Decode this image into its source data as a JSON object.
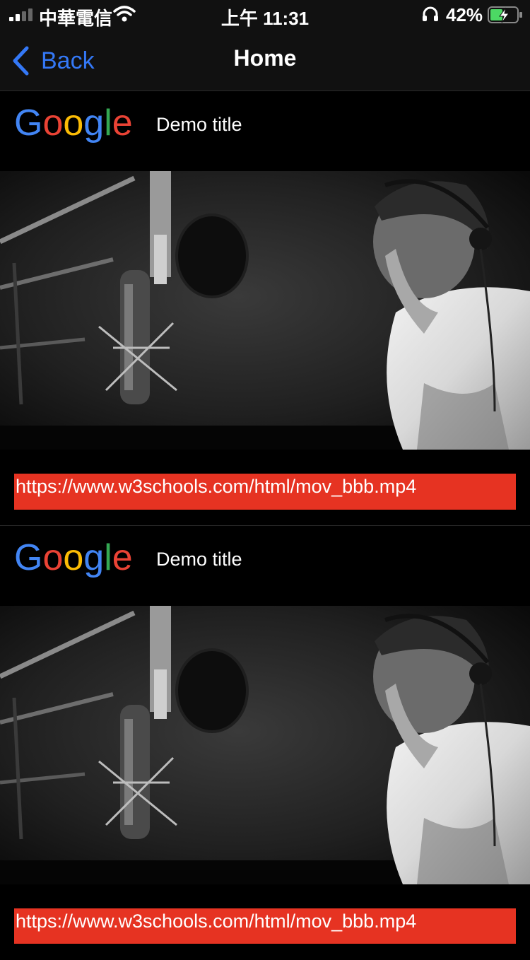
{
  "status_bar": {
    "carrier": "中華電信",
    "time": "上午 11:31",
    "battery_percent": "42%",
    "icons": [
      "signal-icon",
      "wifi-icon",
      "headphones-icon",
      "battery-charging-icon"
    ]
  },
  "nav": {
    "back_label": "Back",
    "title": "Home",
    "accent_color": "#3478f6"
  },
  "feed": [
    {
      "logo": "Google",
      "title": "Demo title",
      "url": "https://www.w3schools.com/html/mov_bbb.mp4"
    },
    {
      "logo": "Google",
      "title": "Demo title",
      "url": "https://www.w3schools.com/html/mov_bbb.mp4"
    }
  ],
  "colors": {
    "background": "#000000",
    "bar_background": "#111111",
    "url_bar": "#e63322",
    "google_blue": "#4285f4",
    "google_red": "#ea4335",
    "google_yellow": "#fbbc05",
    "google_green": "#34a853"
  }
}
